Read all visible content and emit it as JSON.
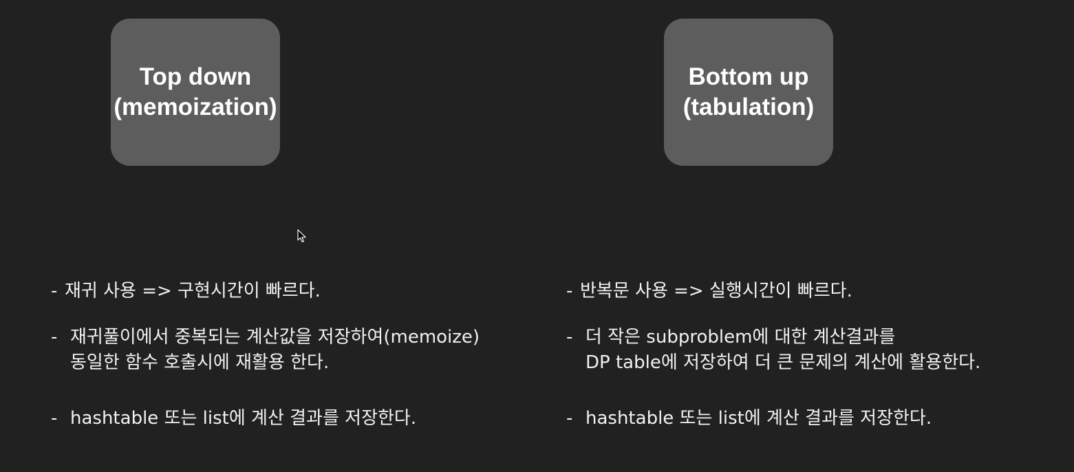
{
  "top_down": {
    "title_line1": "Top down",
    "title_line2": "(memoization)",
    "points": [
      {
        "dash": "-",
        "lines": [
          "재귀 사용 => 구현시간이 빠르다."
        ]
      },
      {
        "dash": "-",
        "lines": [
          "재귀풀이에서 중복되는 계산값을 저장하여(memoize)",
          "동일한 함수 호출시에 재활용 한다."
        ]
      },
      {
        "dash": "-",
        "lines": [
          "hashtable 또는 list에 계산 결과를 저장한다."
        ]
      }
    ]
  },
  "bottom_up": {
    "title_line1": "Bottom up",
    "title_line2": "(tabulation)",
    "points": [
      {
        "dash": "-",
        "lines": [
          "반복문 사용 => 실행시간이 빠르다."
        ]
      },
      {
        "dash": "-",
        "lines": [
          "더 작은 subproblem에 대한 계산결과를",
          "DP table에 저장하여 더 큰 문제의 계산에 활용한다."
        ]
      },
      {
        "dash": "-",
        "lines": [
          "hashtable 또는 list에 계산 결과를 저장한다."
        ]
      }
    ]
  }
}
